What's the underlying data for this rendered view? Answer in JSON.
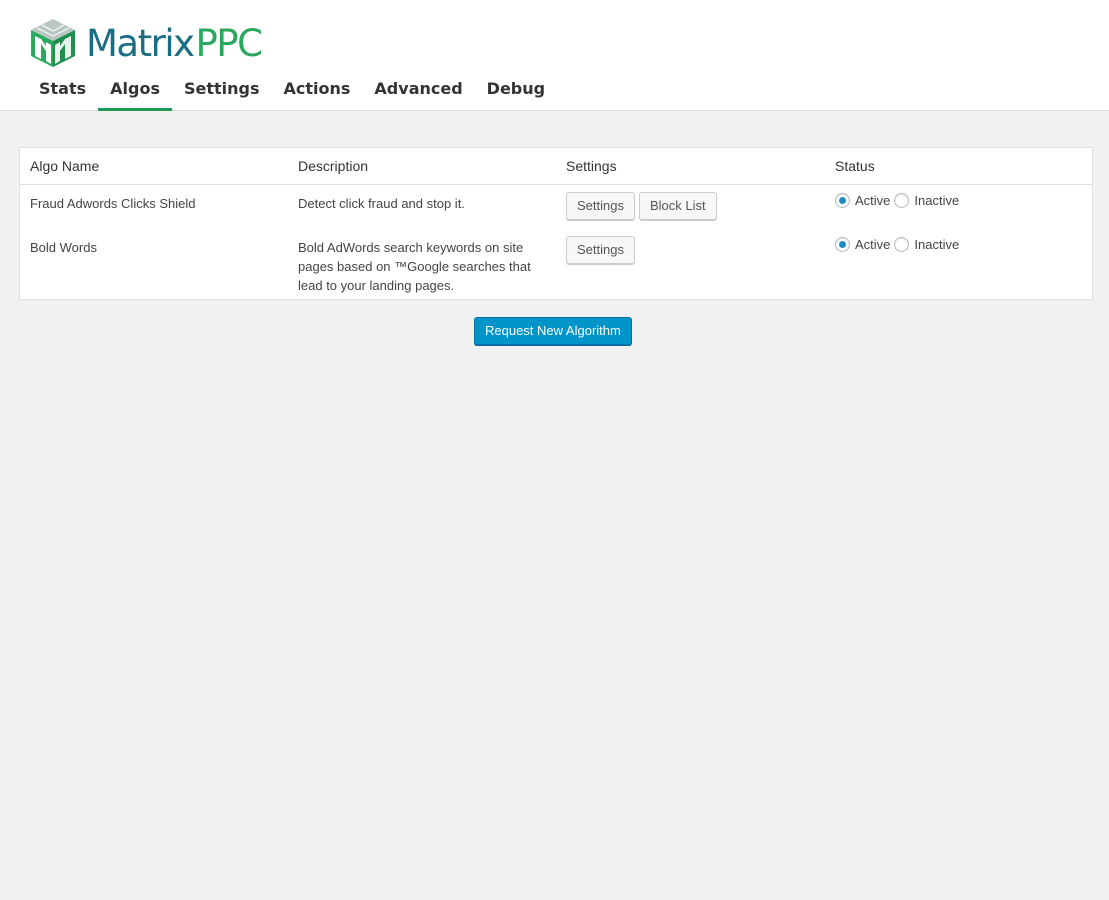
{
  "brand": {
    "name_part1": "Matrix",
    "name_part2": "PPC",
    "primary_color": "#1b6d84",
    "accent_color": "#2aa85e",
    "logo_icon": "m-cube-logo-icon"
  },
  "tabs": [
    {
      "label": "Stats",
      "active": false
    },
    {
      "label": "Algos",
      "active": true
    },
    {
      "label": "Settings",
      "active": false
    },
    {
      "label": "Actions",
      "active": false
    },
    {
      "label": "Advanced",
      "active": false
    },
    {
      "label": "Debug",
      "active": false
    }
  ],
  "table": {
    "headers": {
      "name": "Algo Name",
      "description": "Description",
      "settings": "Settings",
      "status": "Status"
    },
    "rows": [
      {
        "name": "Fraud Adwords Clicks Shield",
        "description": "Detect click fraud and stop it.",
        "buttons": [
          "Settings",
          "Block List"
        ],
        "status_options": [
          "Active",
          "Inactive"
        ],
        "status_selected": "Active"
      },
      {
        "name": "Bold Words",
        "description": "Bold AdWords search keywords on site pages based on ™Google searches that lead to your landing pages.",
        "buttons": [
          "Settings"
        ],
        "status_options": [
          "Active",
          "Inactive"
        ],
        "status_selected": "Active"
      }
    ]
  },
  "request_button": {
    "label": "Request New Algorithm",
    "color": "#0095c8"
  }
}
